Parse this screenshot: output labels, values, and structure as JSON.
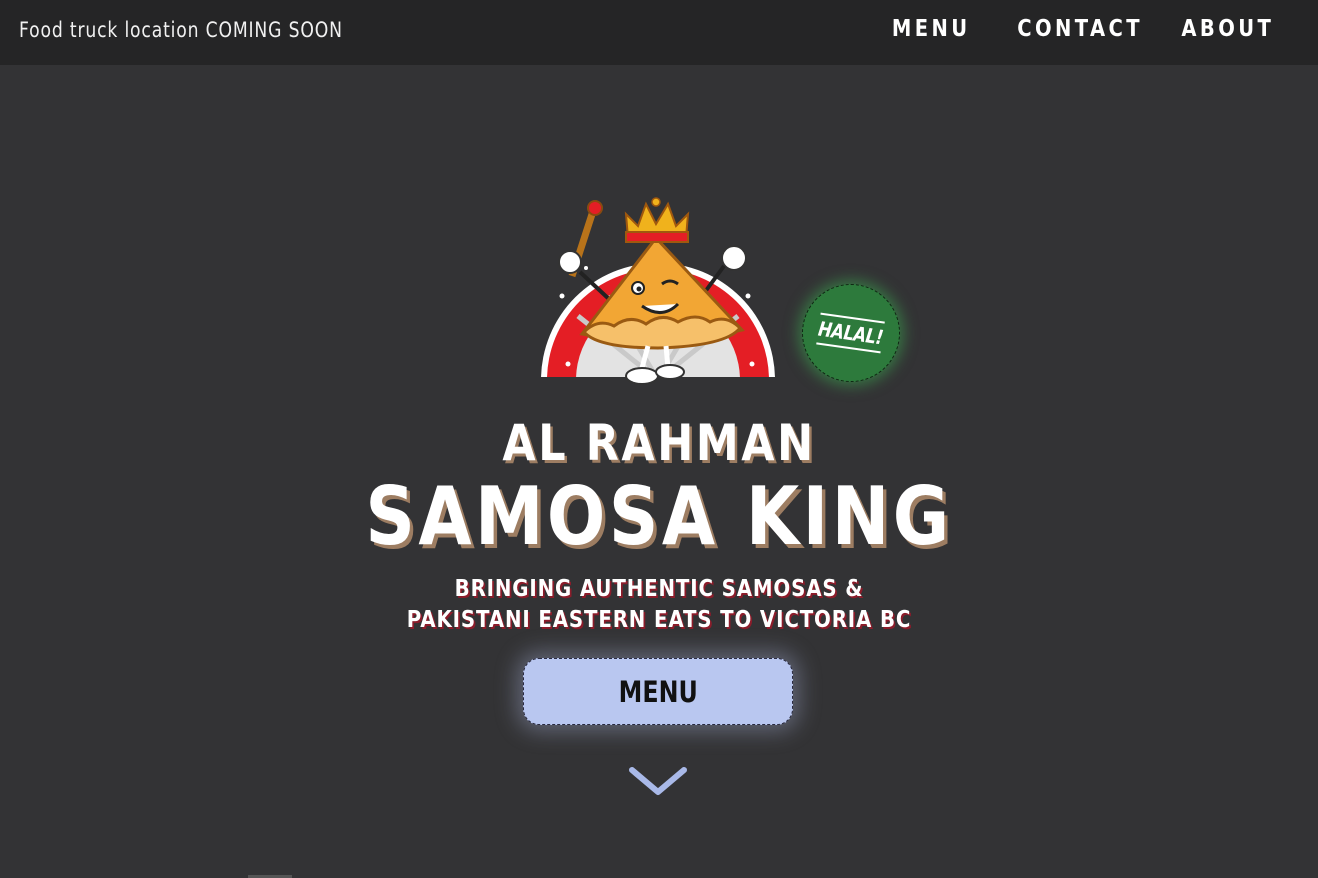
{
  "header": {
    "notice": "Food truck location COMING SOON",
    "nav": [
      {
        "label": "MENU"
      },
      {
        "label": "CONTACT"
      },
      {
        "label": "ABOUT"
      }
    ]
  },
  "hero": {
    "logo_icon": "samosa-king-mascot-icon",
    "badge": "HALAL!",
    "title_top": "AL RAHMAN",
    "title_main": "SAMOSA KING",
    "tagline_line1": "BRINGING AUTHENTIC SAMOSAS &",
    "tagline_line2": "PAKISTANI EASTERN EATS TO VICTORIA BC",
    "menu_button": "MENU",
    "scroll_icon": "chevron-down-icon"
  },
  "colors": {
    "page_bg": "#333335",
    "header_bg": "#252526",
    "badge_green": "#2d7a3c",
    "button_bg": "#b9c7f0",
    "title_shadow": "#9d7d62",
    "tagline_shadow": "#8b1c2a"
  }
}
